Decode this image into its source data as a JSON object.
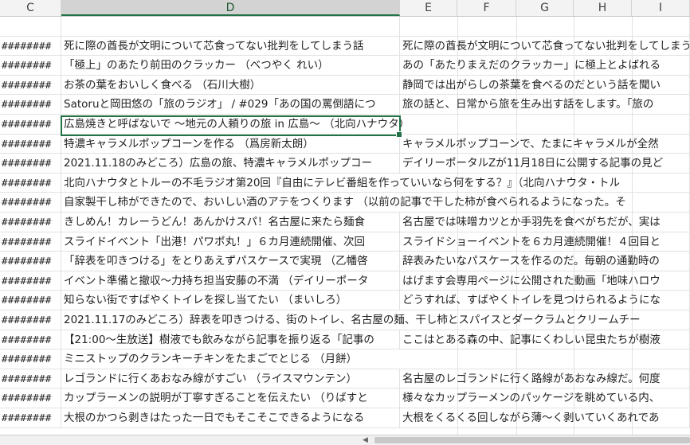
{
  "columns": [
    "C",
    "D",
    "E",
    "F",
    "G",
    "H",
    "I"
  ],
  "selected_column": "D",
  "rows": [
    {
      "c": "",
      "d": "",
      "e": ""
    },
    {
      "c": "########",
      "d": "死に際の酋長が文明について芯食ってない批判をしてしまう話",
      "e": "死に際の酋長が文明について芯食ってない批判をしてしまう話"
    },
    {
      "c": "########",
      "d": "「極上」のあたり前田のクラッカー （べつやく れい）",
      "e": "あの「あたりまえだのクラッカー」に極上とよばれる"
    },
    {
      "c": "########",
      "d": "お茶の葉をおいしく食べる （石川大樹）",
      "e": "静岡では出がらしの茶葉を食べるのだという話を聞い"
    },
    {
      "c": "########",
      "d": "Satoruと岡田悠の「旅のラジオ」 / #029「あの国の罵倒語につ",
      "e": "旅の話と、日常から旅を生み出す話をします。「旅の"
    },
    {
      "c": "########",
      "d": "広島焼きと呼ばないで ～地元の人頼りの旅 in 広島～ （北向ハナウタ）",
      "e": ""
    },
    {
      "c": "########",
      "d": "特濃キャラメルポップコーンを作る （爲房新太朗）",
      "e": "キャラメルポップコーンで、たまにキャラメルが全然"
    },
    {
      "c": "########",
      "d": "2021.11.18のみどころ）広島の旅、特濃キャラメルポップコー",
      "e": "デイリーポータルZが11月18日に公開する記事の見ど"
    },
    {
      "c": "########",
      "d": "北向ハナウタとトルーの不毛ラジオ第20回『自由にテレビ番組を作っていいなら何をする？』（北向ハナウタ・トル",
      "e": ""
    },
    {
      "c": "########",
      "d": "自家製干し柿ができたので、おいしい酒のアテをつくります （以前の記事で干した柿が食べられるようになった。そ",
      "e": ""
    },
    {
      "c": "########",
      "d": "きしめん！カレーうどん！あんかけスパ！名古屋に来たら麺食",
      "e": "名古屋では味噌カツとか手羽先を食べがちだが、実は"
    },
    {
      "c": "########",
      "d": "スライドイベント「出港！パワポ丸！」６カ月連続開催、次回",
      "e": "スライドショーイベントを６カ月連続開催！４回目と"
    },
    {
      "c": "########",
      "d": "「辞表を叩きつける」をとりあえずパスケースで実現 （乙幡啓",
      "e": "辞表みたいなパスケースを作るのだ。毎朝の通勤時の"
    },
    {
      "c": "########",
      "d": "イベント準備と撤収～力持ち担当安藤の不満 （デイリーポータ",
      "e": "はげます会専用ページに公開された動画「地味ハロウ"
    },
    {
      "c": "########",
      "d": "知らない街ですばやくトイレを探し当てたい （まいしろ）",
      "e": "どうすれば、すばやくトイレを見つけられるようにな"
    },
    {
      "c": "########",
      "d": "2021.11.17のみどころ）辞表を叩きつける、街のトイレ、名古屋の麺、干し柿とスパイスとダークラムとクリームチー",
      "e": ""
    },
    {
      "c": "########",
      "d": "【21:00～生放送】樹液でも飲みながら記事を振り返る「記事の",
      "e": "ここはとある森の中、記事にくわしい昆虫たちが樹液"
    },
    {
      "c": "########",
      "d": "ミニストップのクランキーチキンをたまごでとじる （月餅）",
      "e": ""
    },
    {
      "c": "########",
      "d": "レゴランドに行くあおなみ線がすごい （ライスマウンテン）",
      "e": "名古屋のレゴランドに行く路線があおなみ線だ。何度"
    },
    {
      "c": "########",
      "d": "カップラーメンの説明が丁寧すぎることを伝えたい （りばすと",
      "e": "様々なカップラーメンのパッケージを眺めている内、"
    },
    {
      "c": "########",
      "d": "大根のかつら剥きはたった一日でもそこそこできるようになる",
      "e": "大根をくるくる回しながら薄～く剥いていくあれであ"
    }
  ]
}
